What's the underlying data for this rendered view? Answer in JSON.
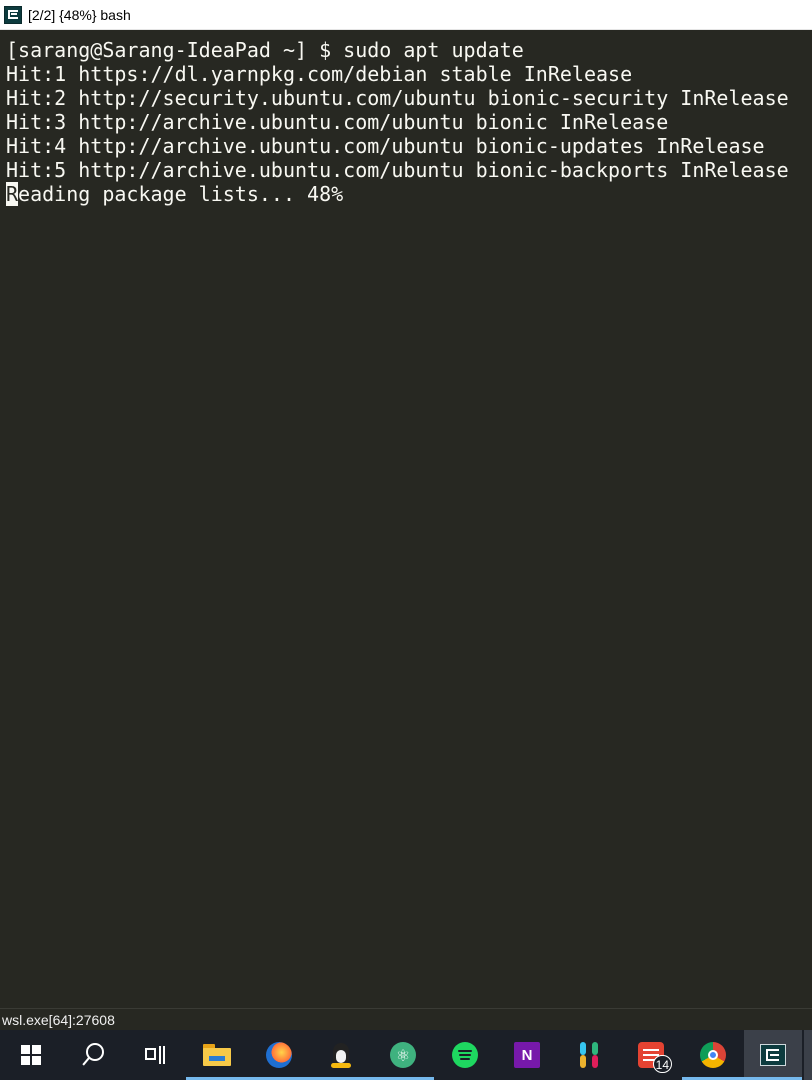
{
  "window": {
    "title": "[2/2] {48%} bash",
    "icon": "terminal-app-icon"
  },
  "terminal": {
    "lines": [
      "[sarang@Sarang-IdeaPad ~] $ sudo apt update",
      "Hit:1 https://dl.yarnpkg.com/debian stable InRelease",
      "Hit:2 http://security.ubuntu.com/ubuntu bionic-security InRelease",
      "Hit:3 http://archive.ubuntu.com/ubuntu bionic InRelease",
      "Hit:4 http://archive.ubuntu.com/ubuntu bionic-updates InRelease",
      "Hit:5 http://archive.ubuntu.com/ubuntu bionic-backports InRelease"
    ],
    "current_line": {
      "cursor_char": "R",
      "rest": "eading package lists... 48%"
    },
    "colors": {
      "background": "#272822",
      "foreground": "#f8f8f2"
    }
  },
  "statusbar": {
    "text": "wsl.exe[64]:27608"
  },
  "taskbar": {
    "items": [
      {
        "name": "start",
        "icon": "windows-start-icon"
      },
      {
        "name": "search",
        "icon": "search-icon"
      },
      {
        "name": "task-view",
        "icon": "task-view-icon"
      },
      {
        "name": "file-explorer",
        "icon": "folder-icon",
        "running": true
      },
      {
        "name": "firefox",
        "icon": "firefox-icon",
        "running": true
      },
      {
        "name": "linux",
        "icon": "linux-penguin-icon",
        "running": true
      },
      {
        "name": "atom",
        "icon": "atom-icon",
        "running": true
      },
      {
        "name": "spotify",
        "icon": "spotify-icon"
      },
      {
        "name": "onenote",
        "icon": "onenote-icon",
        "label": "N"
      },
      {
        "name": "slack",
        "icon": "slack-icon"
      },
      {
        "name": "todoist",
        "icon": "todoist-icon",
        "badge": "14"
      },
      {
        "name": "chrome",
        "icon": "chrome-icon",
        "running": true
      },
      {
        "name": "terminal",
        "icon": "terminal-app-icon",
        "focused": true
      }
    ],
    "colors": {
      "background": "#1b1f27",
      "indicator": "#76b9ed"
    }
  }
}
